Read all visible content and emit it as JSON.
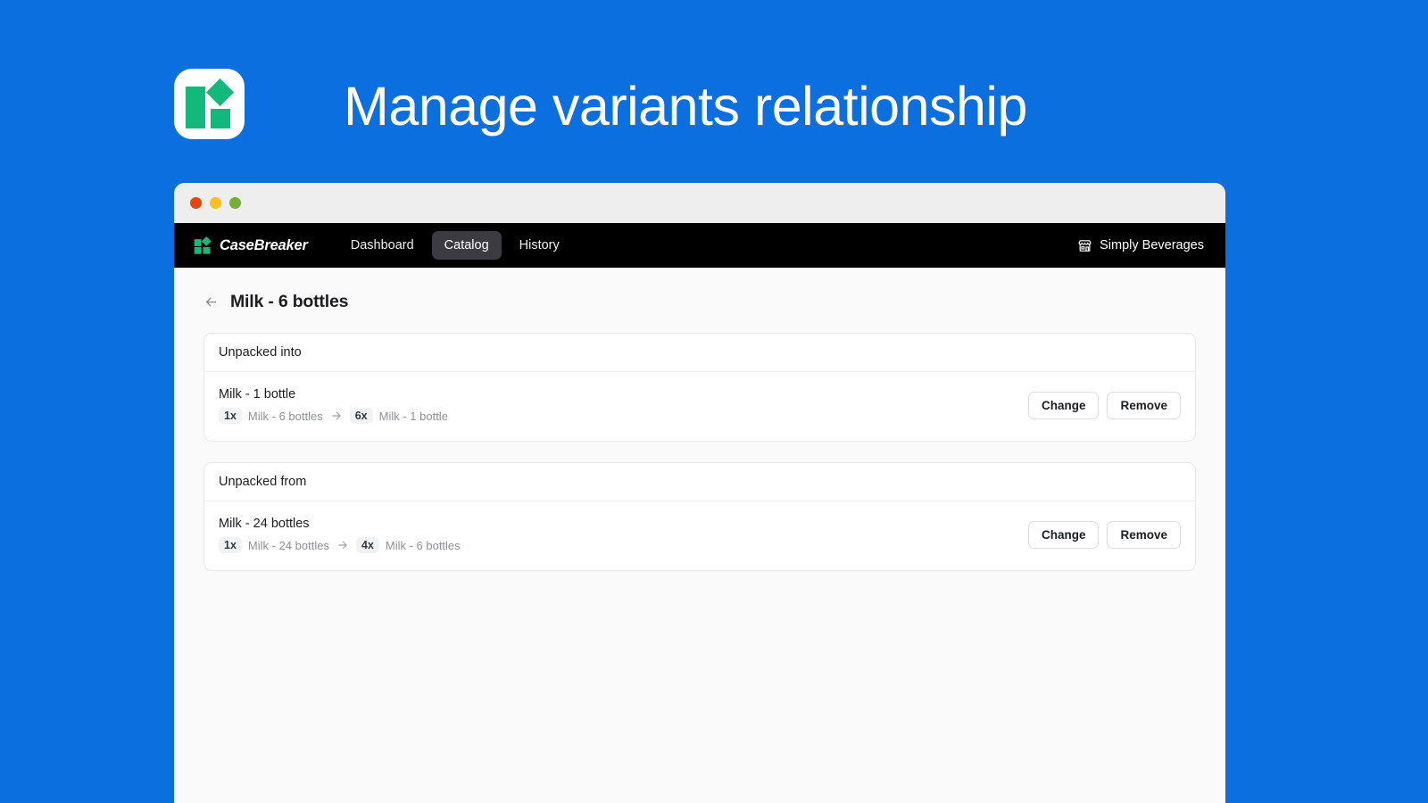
{
  "promo": {
    "headline": "Manage variants relationship",
    "background_color": "#0b6fdf",
    "app_icon_name": "casebreaker-app-icon",
    "icon_accent_color": "#14b87c"
  },
  "window": {
    "traffic_lights": [
      {
        "name": "close",
        "color": "#e8440d"
      },
      {
        "name": "minimize",
        "color": "#ffbd1f"
      },
      {
        "name": "zoom",
        "color": "#74ae34"
      }
    ]
  },
  "navbar": {
    "brand": "CaseBreaker",
    "links": [
      {
        "label": "Dashboard",
        "active": false
      },
      {
        "label": "Catalog",
        "active": true
      },
      {
        "label": "History",
        "active": false
      }
    ],
    "store_name": "Simply Beverages",
    "store_icon": "storefront-icon"
  },
  "page": {
    "back_icon": "arrow-left-icon",
    "title": "Milk - 6 bottles",
    "cards": [
      {
        "header": "Unpacked into",
        "rows": [
          {
            "title": "Milk - 1 bottle",
            "from_qty": "1x",
            "from_label": "Milk - 6 bottles",
            "arrow_icon": "arrow-right-icon",
            "to_qty": "6x",
            "to_label": "Milk - 1 bottle",
            "change_label": "Change",
            "remove_label": "Remove"
          }
        ]
      },
      {
        "header": "Unpacked from",
        "rows": [
          {
            "title": "Milk - 24 bottles",
            "from_qty": "1x",
            "from_label": "Milk - 24 bottles",
            "arrow_icon": "arrow-right-icon",
            "to_qty": "4x",
            "to_label": "Milk - 6 bottles",
            "change_label": "Change",
            "remove_label": "Remove"
          }
        ]
      }
    ]
  }
}
